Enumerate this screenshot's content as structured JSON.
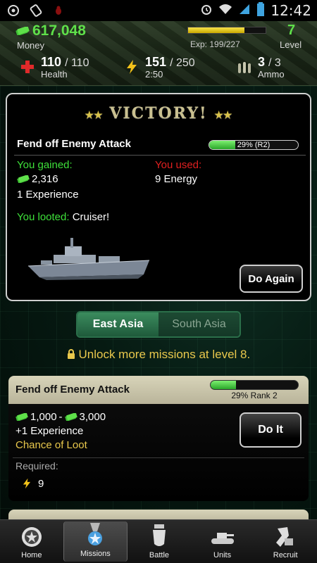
{
  "statusbar": {
    "time": "12:42"
  },
  "header": {
    "money": "617,048",
    "money_label": "Money",
    "exp_text": "Exp: 199/227",
    "exp_progress": 0.73,
    "level": "7",
    "level_label": "Level",
    "health_cur": "110",
    "health_max": "/ 110",
    "health_label": "Health",
    "energy_cur": "151",
    "energy_max": "/ 250",
    "energy_timer": "2:50",
    "ammo_cur": "3",
    "ammo_max": "/ 3",
    "ammo_label": "Ammo"
  },
  "victory": {
    "title": "VICTORY!",
    "mission": "Fend off Enemy Attack",
    "progress_text": "29% (R2)",
    "progress": 0.29,
    "gained_label": "You gained:",
    "gained_money": "2,316",
    "gained_exp": "1 Experience",
    "used_label": "You used:",
    "used_energy": "9 Energy",
    "looted_label": "You looted:",
    "looted_item": "Cruiser!",
    "again_button": "Do Again"
  },
  "regions": {
    "tabs": [
      "East Asia",
      "South Asia"
    ],
    "active": 0
  },
  "unlock_text": "Unlock more missions at level 8.",
  "mission_card": {
    "title": "Fend off Enemy Attack",
    "progress": 0.29,
    "rank_text": "29% Rank 2",
    "money_min": "1,000",
    "money_sep": "-",
    "money_max": "3,000",
    "exp": "+1 Experience",
    "loot": "Chance of Loot",
    "required_label": "Required:",
    "required_energy": "9",
    "do_button": "Do It"
  },
  "nav": {
    "items": [
      "Home",
      "Missions",
      "Battle",
      "Units",
      "Recruit"
    ],
    "active": 1
  },
  "colors": {
    "money_green": "#5fe04a",
    "gain_green": "#3ee03a",
    "used_red": "#e02020",
    "gold": "#e9c84c"
  }
}
